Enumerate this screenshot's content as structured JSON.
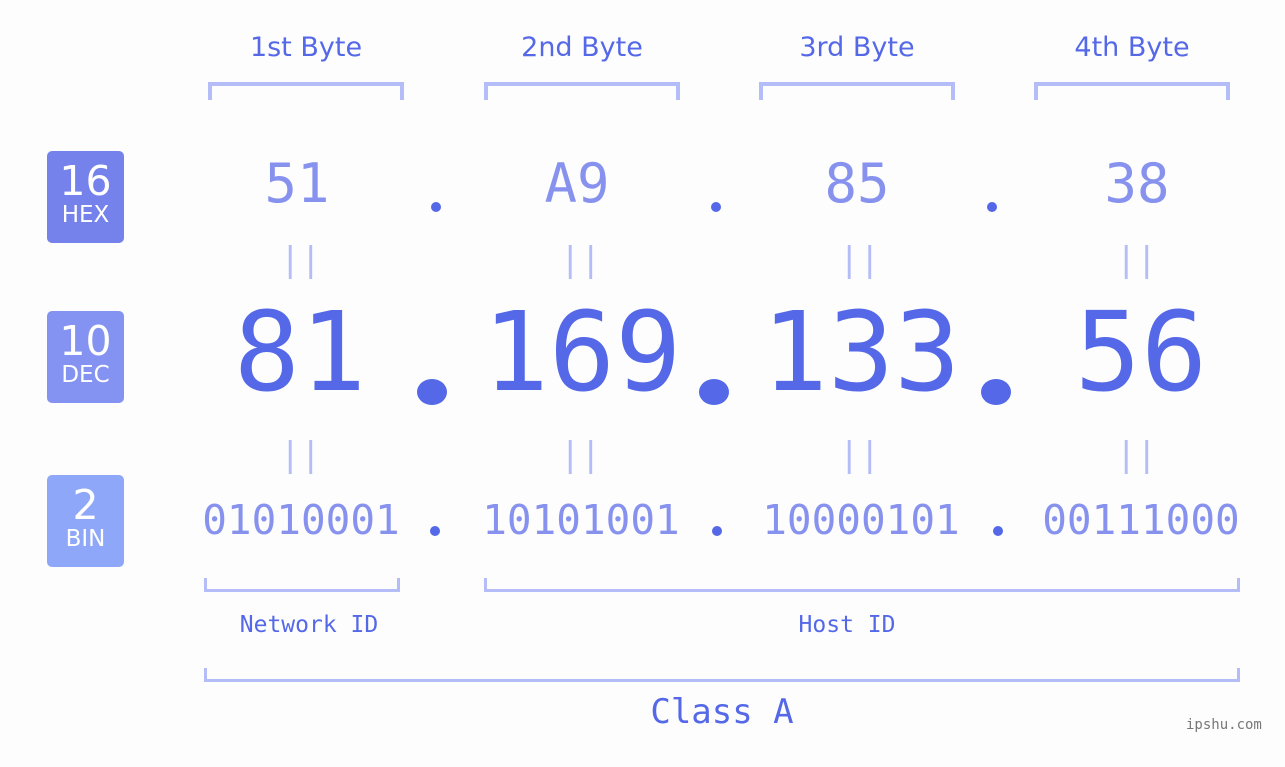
{
  "byte_headers": [
    "1st Byte",
    "2nd Byte",
    "3rd Byte",
    "4th Byte"
  ],
  "badges": {
    "hex": {
      "base": "16",
      "label": "HEX",
      "color": "#7582eb"
    },
    "dec": {
      "base": "10",
      "label": "DEC",
      "color": "#8493f1"
    },
    "bin": {
      "base": "2",
      "label": "BIN",
      "color": "#8fa7f8"
    }
  },
  "hex_values": [
    "51",
    "A9",
    "85",
    "38"
  ],
  "dec_values": [
    "81",
    "169",
    "133",
    "56"
  ],
  "bin_values": [
    "01010001",
    "10101001",
    "10000101",
    "00111000"
  ],
  "equals_sign": "||",
  "network_id_label": "Network ID",
  "host_id_label": "Host ID",
  "class_label": "Class A",
  "watermark": "ipshu.com",
  "colors": {
    "accent": "#5468e8",
    "light": "#8792ee",
    "bracket": "#b4bdf8"
  }
}
